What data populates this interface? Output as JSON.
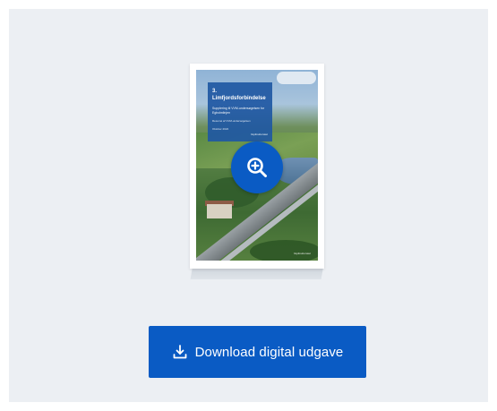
{
  "cover": {
    "title": "3. Limfjordsforbindelse",
    "subtitle": "Supplering til VVM-undersøgelsen for Egholmlinjen",
    "line3": "Resumé af VVM-undersøgelsen",
    "line4": "Oktober 2022",
    "brand": "Vejdirektoratet",
    "footer_mark": "Vejdirektoratet"
  },
  "zoom": {
    "icon": "zoom-in-icon"
  },
  "download": {
    "label": "Download digital udgave",
    "icon": "download-icon"
  },
  "colors": {
    "accent": "#0a5bc4",
    "panel_bg": "#eceff3"
  }
}
